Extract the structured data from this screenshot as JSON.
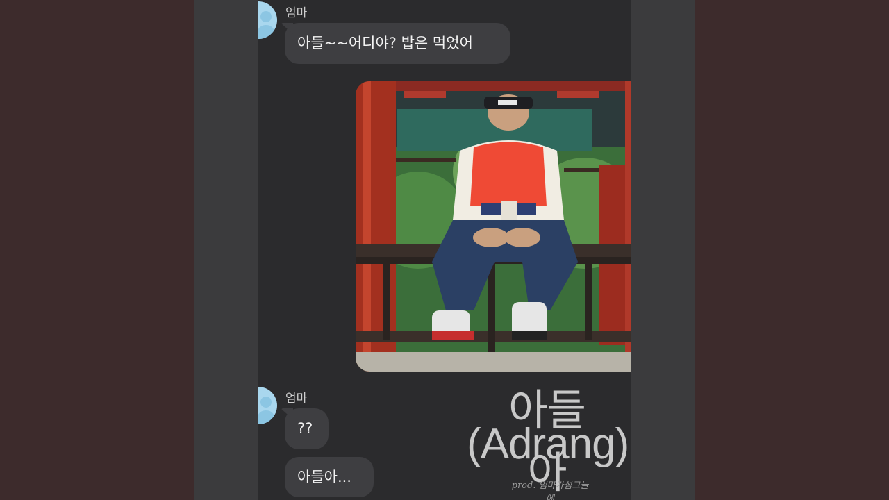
{
  "conversation": {
    "messages": [
      {
        "sender": "엄마",
        "bubbles": [
          "아들~~어디야? 밥은 먹었어"
        ]
      },
      {
        "sender": "엄마",
        "bubbles": [
          "??",
          "아들아..."
        ]
      }
    ]
  },
  "cover": {
    "title_korean": "아들아",
    "title_english": "(Adrang)",
    "producer_credit": "prod. 엄마가섬그늘에"
  },
  "colors": {
    "background": "#3d2b2c",
    "chat_background": "#2b2b2d",
    "bubble": "#3e3e41",
    "avatar": "#a9d7ee"
  },
  "icons": {
    "avatar": "profile-silhouette-icon"
  }
}
